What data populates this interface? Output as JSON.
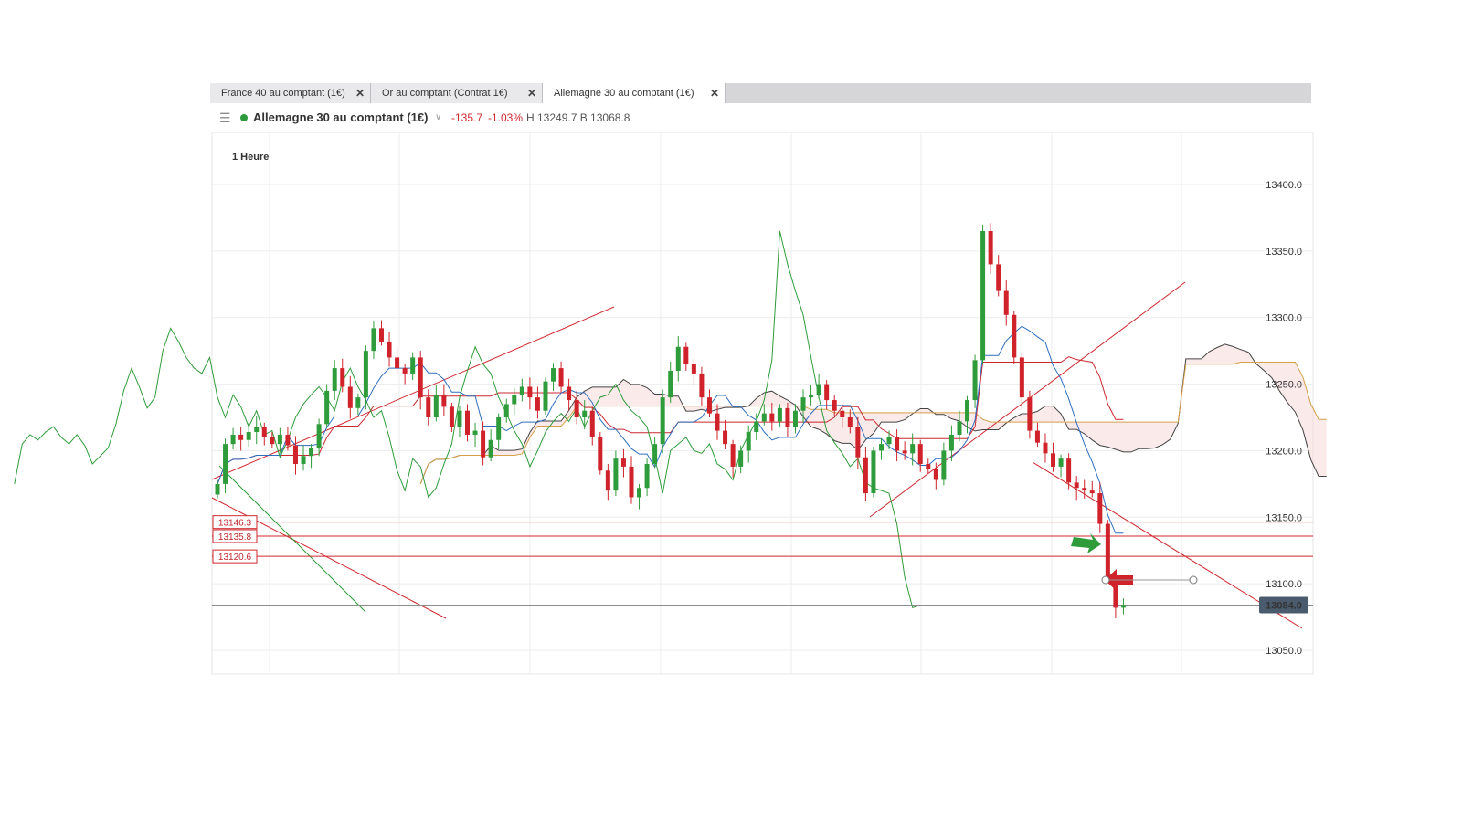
{
  "tabs": [
    {
      "label": "France 40 au comptant (1€)",
      "close": "✕"
    },
    {
      "label": "Or au comptant (Contrat 1€)",
      "close": "✕"
    },
    {
      "label": "Allemagne 30 au comptant (1€)",
      "close": "✕",
      "active": true
    }
  ],
  "instrument": {
    "menu_icon": "hamburger-icon",
    "status_color": "#2d9a3b",
    "name": "Allemagne 30 au comptant (1€)",
    "change": "-135.7",
    "change_pct": "-1.03%",
    "high_low": "H 13249.7 B 13068.8"
  },
  "timeframe": "1 Heure",
  "colors": {
    "bull": "#2e9c3a",
    "bear": "#d0222a",
    "level_line": "#d0282f",
    "tenkan": "#2e6fc0",
    "kijun": "#c8282f",
    "chikou": "#2e9c3a",
    "span_a": "#444444",
    "span_b": "#d4a04a",
    "price_tag": "#4a5b6e"
  },
  "chart_data": {
    "type": "candlestick",
    "ylim": [
      13030,
      13440
    ],
    "y_ticks": [
      "13400.0",
      "13350.0",
      "13300.0",
      "13250.0",
      "13200.0",
      "13150.0",
      "13100.0",
      "13050.0"
    ],
    "horizontal_levels": [
      {
        "label": "13146.3",
        "value": 13146.3
      },
      {
        "label": "13135.8",
        "value": 13135.8
      },
      {
        "label": "13120.6",
        "value": 13120.6
      }
    ],
    "last_price": {
      "label": "13084.0",
      "value": 13084.0
    },
    "close_series": [
      13175,
      13205,
      13212,
      13208,
      13214,
      13218,
      13210,
      13205,
      13212,
      13204,
      13190,
      13196,
      13202,
      13220,
      13245,
      13262,
      13248,
      13232,
      13240,
      13275,
      13292,
      13282,
      13270,
      13262,
      13258,
      13270,
      13240,
      13225,
      13242,
      13233,
      13218,
      13230,
      13212,
      13215,
      13195,
      13208,
      13225,
      13235,
      13242,
      13248,
      13240,
      13230,
      13252,
      13262,
      13248,
      13238,
      13225,
      13230,
      13210,
      13185,
      13170,
      13194,
      13188,
      13165,
      13172,
      13190,
      13205,
      13240,
      13260,
      13278,
      13265,
      13258,
      13240,
      13228,
      13215,
      13205,
      13188,
      13200,
      13214,
      13222,
      13228,
      13222,
      13232,
      13218,
      13230,
      13240,
      13242,
      13250,
      13238,
      13230,
      13225,
      13218,
      13195,
      13168,
      13200,
      13205,
      13210,
      13200,
      13198,
      13205,
      13190,
      13186,
      13178,
      13200,
      13212,
      13222,
      13238,
      13268,
      13365,
      13340,
      13320,
      13302,
      13270,
      13240,
      13215,
      13206,
      13198,
      13188,
      13194,
      13176,
      13172,
      13170,
      13168,
      13145,
      13105,
      13082,
      13084
    ]
  },
  "annotations": {
    "green_arrow": "arrow-right-icon",
    "red_arrow": "arrow-left-icon"
  }
}
